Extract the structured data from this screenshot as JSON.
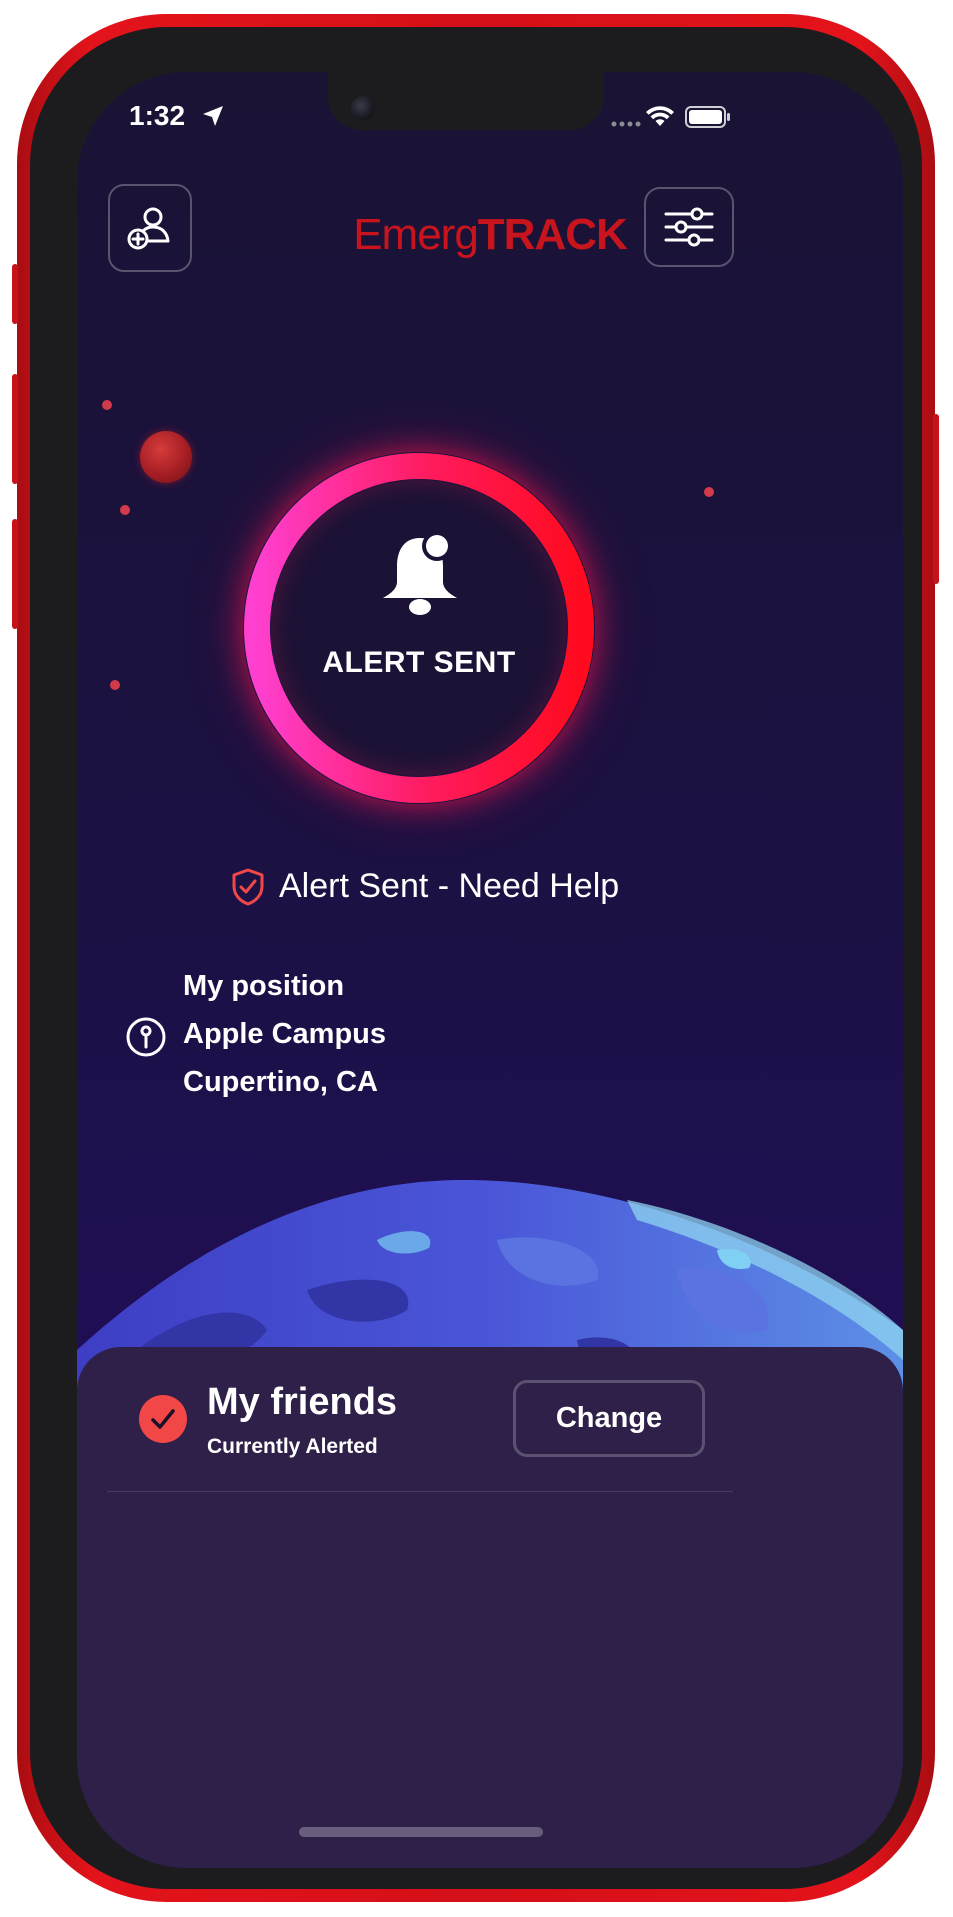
{
  "status_bar": {
    "time": "1:32",
    "icons": [
      "location-arrow-icon",
      "cellular-icon",
      "wifi-icon",
      "battery-icon"
    ]
  },
  "header": {
    "logo_light": "Emerg",
    "logo_bold": "TRACK",
    "left_button_icon": "add-contact-icon",
    "right_button_icon": "sliders-icon"
  },
  "alert_button": {
    "label": "ALERT SENT",
    "icon": "bell-icon"
  },
  "status": {
    "icon": "shield-check-icon",
    "text": "Alert Sent - Need Help"
  },
  "position": {
    "icon": "map-pin-icon",
    "title": "My position",
    "line1": "Apple Campus",
    "line2": "Cupertino, CA"
  },
  "friends_card": {
    "title": "My friends",
    "subtitle": "Currently Alerted",
    "button_label": "Change",
    "icon": "check-circle-icon"
  },
  "colors": {
    "brand_red": "#c8141c",
    "accent_red": "#f24747",
    "ring_pink": "#ff3fcf",
    "ring_red": "#ff0a1e",
    "background": "#1c1143",
    "card": "#2e2048"
  }
}
